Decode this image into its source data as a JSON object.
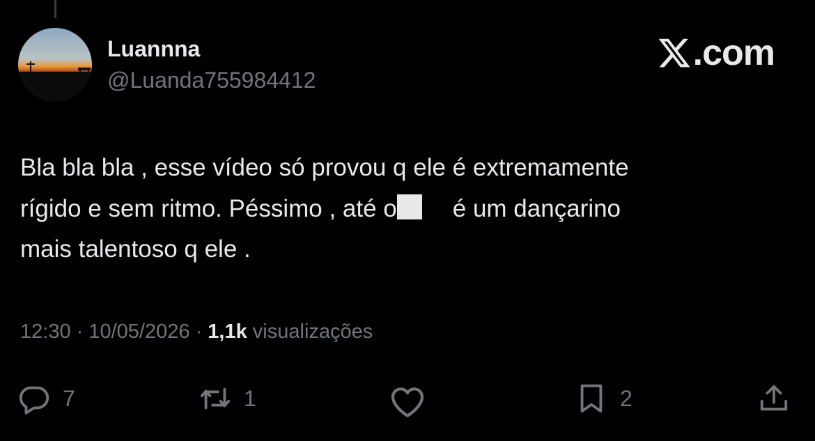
{
  "author": {
    "name": "Luannna",
    "handle": "@Luanda755984412"
  },
  "watermark": ".com",
  "tweet": {
    "line1": "Bla bla bla , esse vídeo só provou q ele é extremamente",
    "line2_a": "rígido e sem ritmo. Péssimo , até o",
    "line2_b": "é um dançarino",
    "line3": "mais talentoso q ele ."
  },
  "meta": {
    "time": "12:30",
    "sep1": " · ",
    "date": "10/05/2026",
    "sep2": " · ",
    "views_count": "1,1k",
    "views_label": " visualizações"
  },
  "actions": {
    "replies": "7",
    "reposts": "1",
    "bookmarks": "2"
  },
  "icons": [
    "x-logo-icon",
    "reply-icon",
    "repost-icon",
    "like-icon",
    "bookmark-icon",
    "share-icon"
  ],
  "colors": {
    "background": "#000000",
    "text": "#e7e9ea",
    "muted": "#71767b"
  }
}
